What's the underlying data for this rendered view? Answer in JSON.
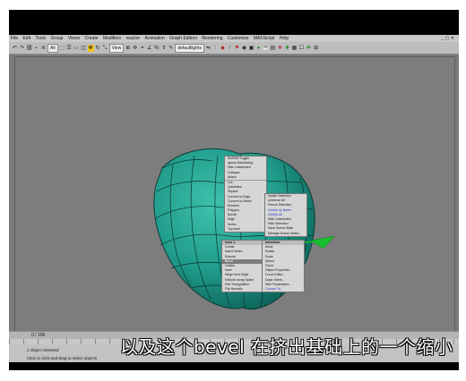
{
  "menubar": {
    "items": [
      "File",
      "Edit",
      "Tools",
      "Group",
      "Views",
      "Create",
      "Modifiers",
      "reactor",
      "Animation",
      "Graph Editors",
      "Rendering",
      "Customize",
      "MAXScript",
      "Help"
    ]
  },
  "toolbar": {
    "selection_filter": "All",
    "view_dropdown": "View",
    "named_selection": "defaultlights"
  },
  "quad_menu": {
    "top_left": [
      "NURMS Toggle",
      "Ignore Backfacing",
      "Hide Unselected",
      "Collapse",
      "Attach",
      "Cut",
      "Quickslice",
      "Repeat",
      "Convert to Edge",
      "Convert to Vertex",
      "Element",
      "Polygon",
      "Border",
      "Edge",
      "Vertex",
      "Top-level"
    ],
    "top_right": [
      "Isolate Selection",
      "Unfreeze All",
      "Freeze Selection",
      "Unhide by Name",
      "Unhide All",
      "Hide Unselected",
      "Hide Selection",
      "Save Scene State",
      "Manage Scene States..."
    ],
    "bottom_left_header": "tools 1",
    "bottom_left": [
      "Create",
      "Insert Vertex",
      "Extrude",
      "Bevel",
      "Outline",
      "Inset",
      "Hinge from Edge",
      "Extrude along Spline",
      "Edit Triangulation",
      "Flip Normals"
    ],
    "bottom_right_header": "transform",
    "bottom_right": [
      "Move",
      "Rotate",
      "Scale",
      "Select",
      "Clone",
      "Object Properties...",
      "Curve Editor...",
      "Dope Sheet...",
      "Wire Parameters...",
      "Convert To:"
    ],
    "highlighted": "Bevel",
    "blue_items": [
      "Unhide by Name",
      "Unhide All",
      "Convert To:"
    ]
  },
  "timeline": {
    "frame": "0 / 100"
  },
  "status": {
    "selection": "1 Object Selected",
    "prompt": "Click or click-and-drag to select objects"
  },
  "subtitle": "以及这个bevel  在挤出基础上的一个缩小",
  "colors": {
    "object": "#1f9b8a",
    "viewport_bg": "#7d7d7d",
    "gizmo": "#18c02e",
    "menu_highlight": "#7c7c7c"
  }
}
